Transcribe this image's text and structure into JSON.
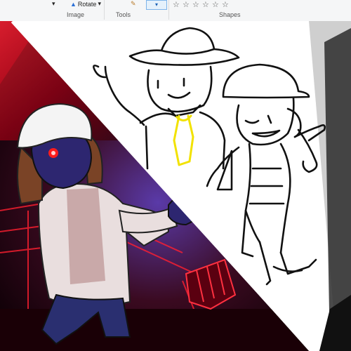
{
  "ribbon": {
    "rotate_label": "Rotate",
    "groups": {
      "image": "Image",
      "tools": "Tools",
      "shapes": "Shapes"
    }
  },
  "icons": [
    "rotate-icon",
    "brush-icon",
    "star-shape-icon",
    "dropdown-arrow-icon"
  ],
  "colors": {
    "frame_red": "#c8102e",
    "frame_dark": "#1a0000",
    "lineart": "#111111",
    "tie_yellow": "#f2e200",
    "coat": "#e9dede",
    "skin_navy": "#2d2670",
    "hair_brown": "#7a4326",
    "cap_white": "#f4f4f4",
    "eye_red": "#ff1c1c"
  }
}
